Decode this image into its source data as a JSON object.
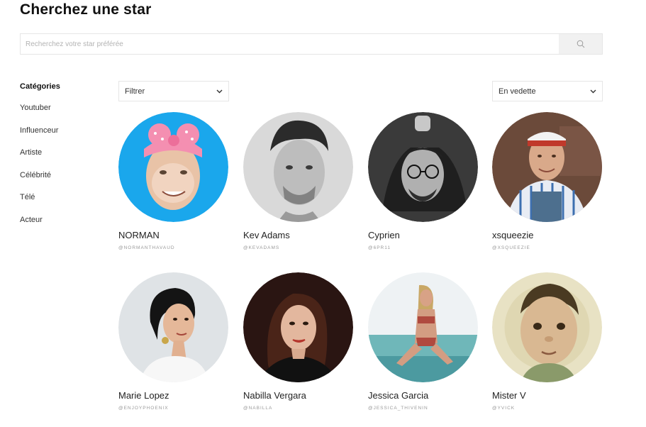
{
  "header": {
    "title": "Cherchez une star"
  },
  "search": {
    "placeholder": "Recherchez votre star préférée",
    "icon": "search-icon"
  },
  "sidebar": {
    "heading": "Catégories",
    "items": [
      {
        "label": "Youtuber"
      },
      {
        "label": "Influenceur"
      },
      {
        "label": "Artiste"
      },
      {
        "label": "Célébrité"
      },
      {
        "label": "Télé"
      },
      {
        "label": "Acteur"
      }
    ]
  },
  "filter": {
    "label": "Filtrer",
    "icon": "chevron-down-icon"
  },
  "sort": {
    "label": "En vedette",
    "icon": "chevron-down-icon"
  },
  "stars": [
    {
      "name": "NORMAN",
      "handle": "@NORMANTHAVAUD"
    },
    {
      "name": "Kev Adams",
      "handle": "@KEVADAMS"
    },
    {
      "name": "Cyprien",
      "handle": "@6PR11"
    },
    {
      "name": "xsqueezie",
      "handle": "@XSQUEEZIE"
    },
    {
      "name": "Marie Lopez",
      "handle": "@ENJOYPHOENIX"
    },
    {
      "name": "Nabilla Vergara",
      "handle": "@NABILLA"
    },
    {
      "name": "Jessica Garcia",
      "handle": "@JESSICA_THIVENIN"
    },
    {
      "name": "Mister V",
      "handle": "@YVICK"
    }
  ],
  "colors": {
    "accent_blue": "#1aa7ec",
    "text": "#222222",
    "muted": "#9a9a9a",
    "border": "#e6e6e6"
  }
}
